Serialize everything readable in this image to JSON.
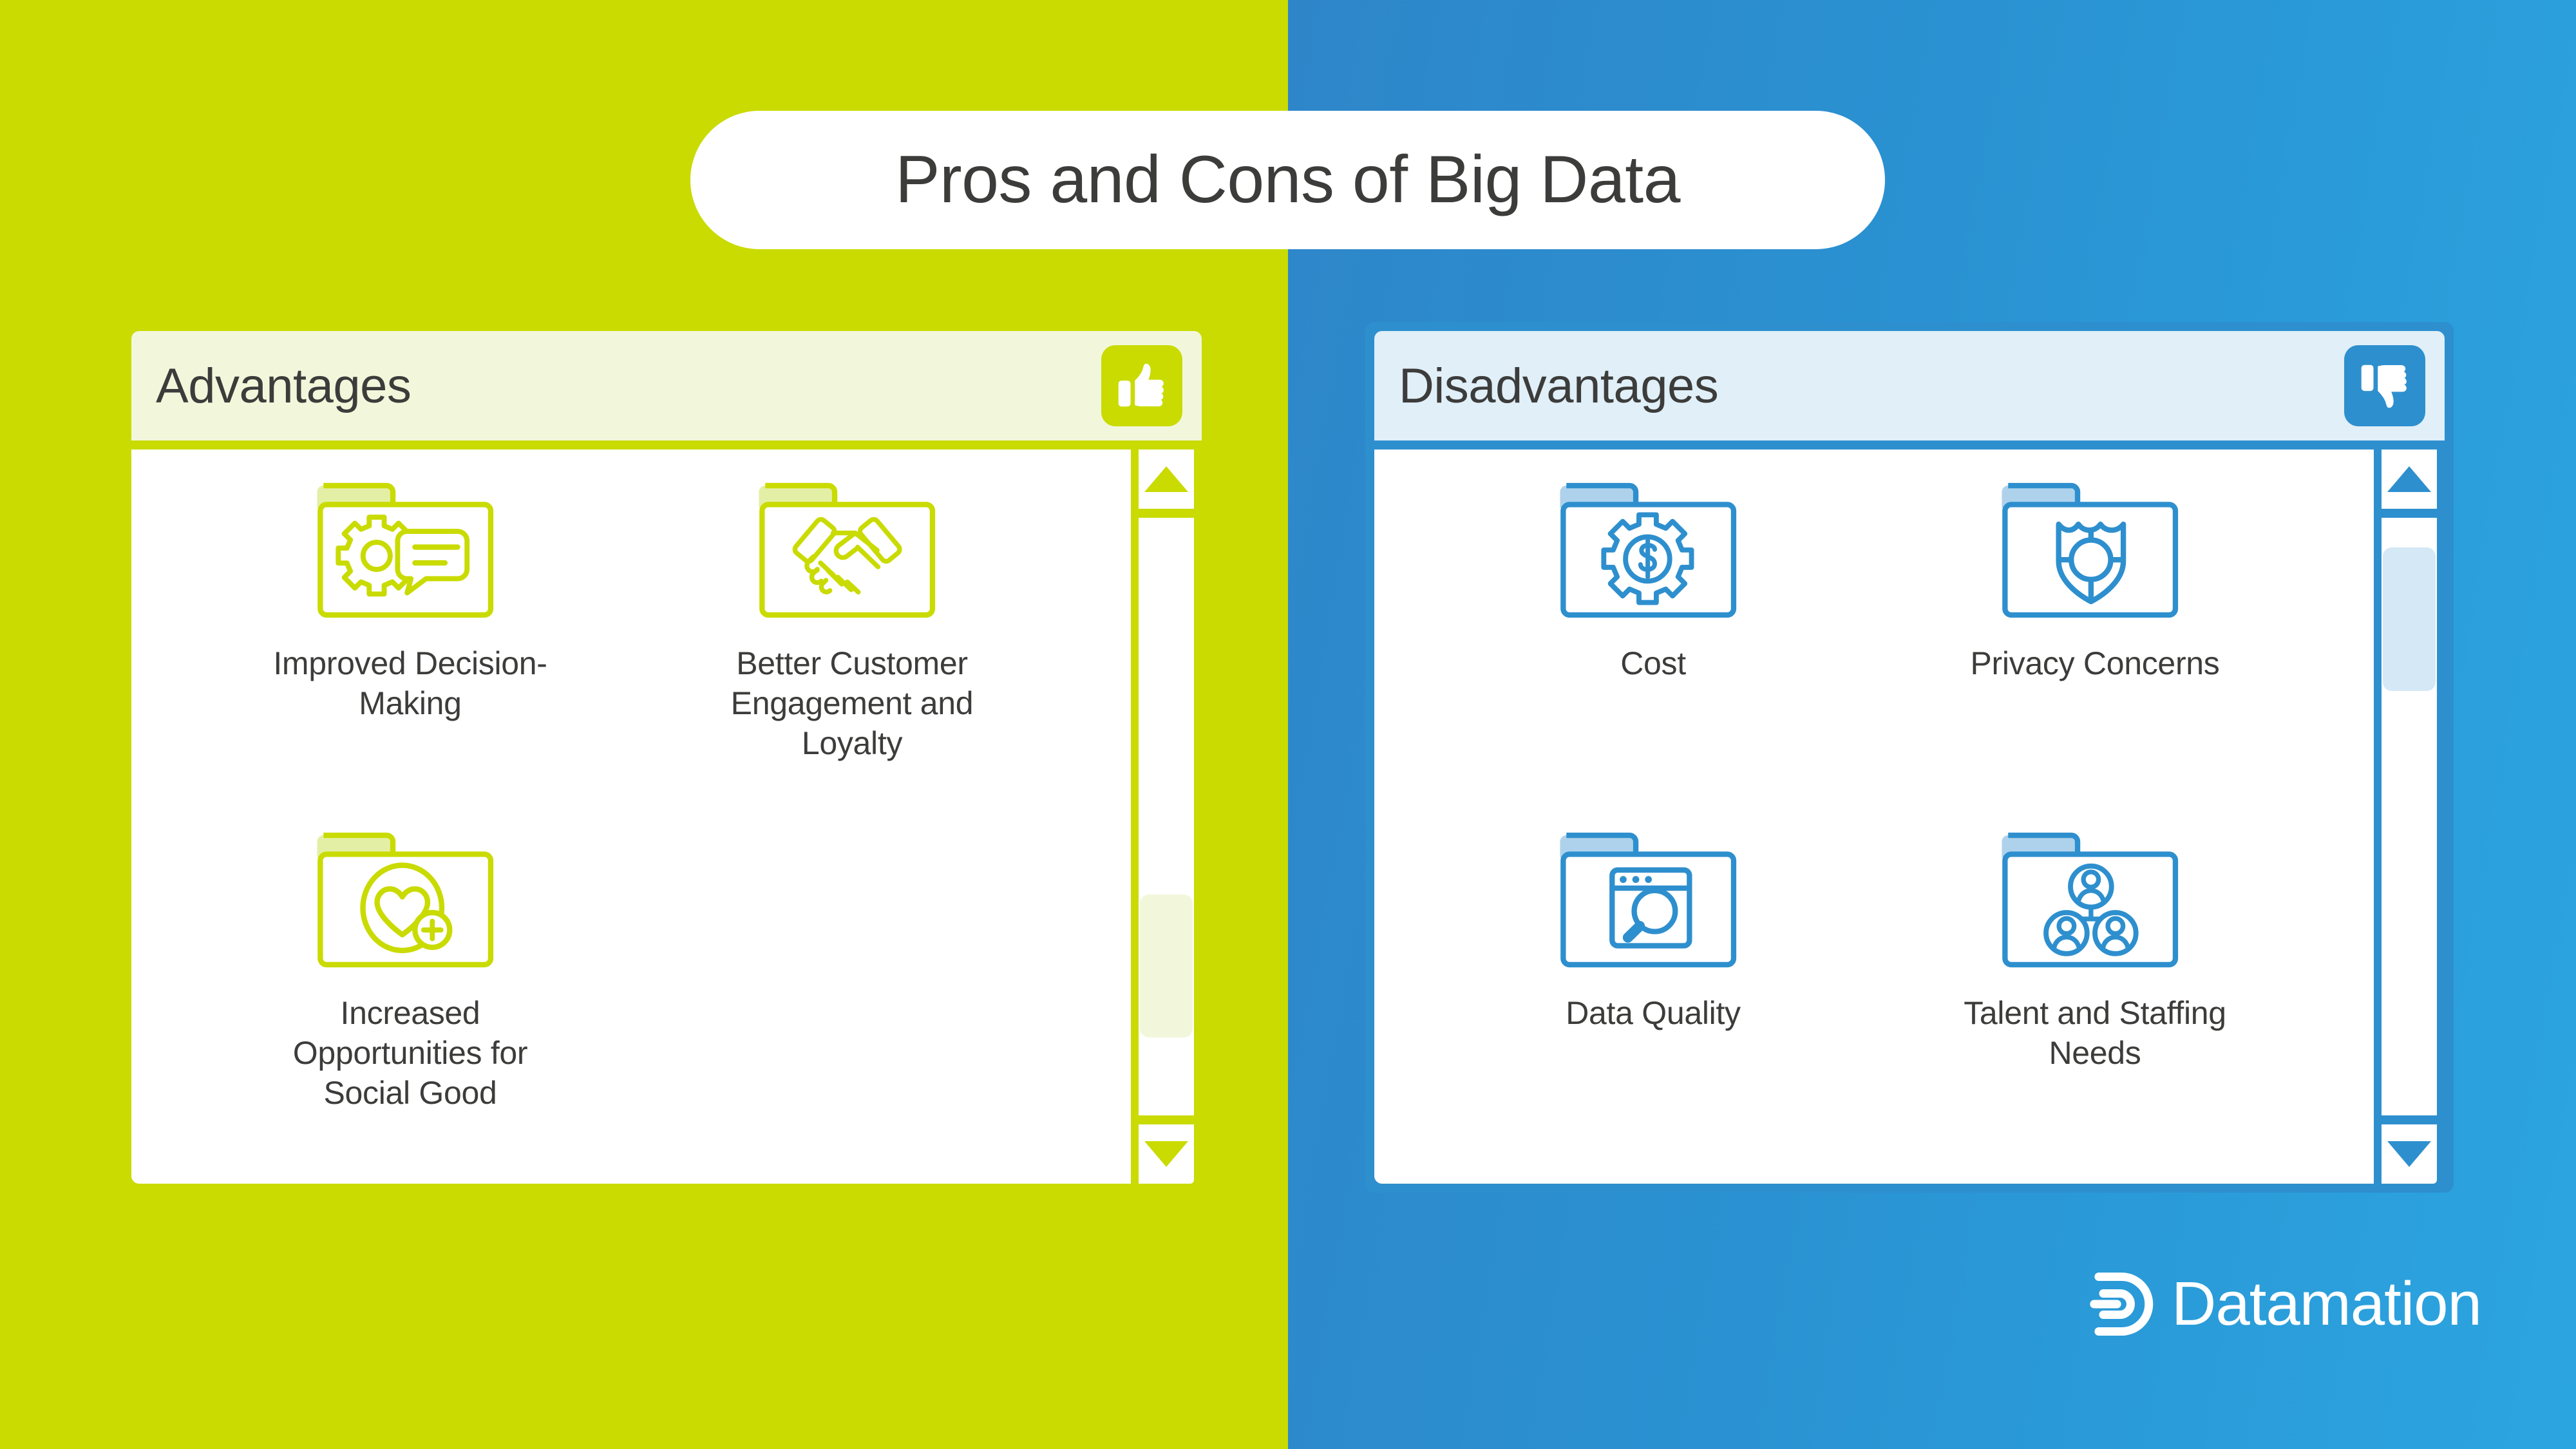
{
  "title": "Pros and Cons of Big Data",
  "theme": {
    "green": "#C9DB00",
    "green_pale": "#F2F7DB",
    "blue": "#2E8FCE",
    "blue_pale": "#E0EFF8",
    "text_dark": "#3C3C3B",
    "white": "#FFFFFF"
  },
  "panels": {
    "advantages": {
      "title": "Advantages",
      "badge_icon": "thumbs-up-icon",
      "scroll": {
        "thumb_top_pct": 63,
        "thumb_height_pct": 24
      },
      "items": [
        {
          "label": "Improved\nDecision-Making",
          "icon": "folder-gear-chat-icon"
        },
        {
          "label": "Better Customer Engagement and Loyalty",
          "icon": "folder-handshake-icon"
        },
        {
          "label": "Increased Opportunities for Social Good",
          "icon": "folder-heart-plus-icon"
        }
      ]
    },
    "disadvantages": {
      "title": "Disadvantages",
      "badge_icon": "thumbs-down-icon",
      "scroll": {
        "thumb_top_pct": 5,
        "thumb_height_pct": 24
      },
      "items": [
        {
          "label": "Cost",
          "icon": "folder-gear-dollar-icon"
        },
        {
          "label": "Privacy Concerns",
          "icon": "folder-shield-icon"
        },
        {
          "label": "Data Quality",
          "icon": "folder-window-search-icon"
        },
        {
          "label": "Talent and Staffing Needs",
          "icon": "folder-people-group-icon"
        }
      ]
    }
  },
  "brand": {
    "name": "Datamation",
    "mark": "datamation-d-mark-icon"
  }
}
